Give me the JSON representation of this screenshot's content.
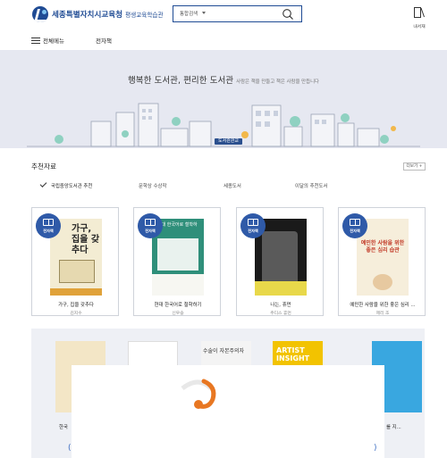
{
  "header": {
    "logo_name": "세종특별자치시교육청",
    "logo_sub": "평생교육학습관",
    "search_select": "통합검색",
    "mylib_label": "내서재"
  },
  "nav": {
    "menu_label": "전체메뉴",
    "item": "전자책"
  },
  "banner": {
    "main": "행복한 도서관, 편리한 도서관",
    "sub": "사람은 책을 만들고 책은 사람을 만듭니다",
    "sign": "도서관관교"
  },
  "recommended": {
    "title": "추천자료",
    "more": "더보기 +",
    "tabs": [
      "국립중앙도서관 추천",
      "문학상 수상작",
      "세종도서",
      "이달의 추천도서"
    ],
    "badge_label": "전자책",
    "books": [
      {
        "title": "가구, 집을 갖추다",
        "author": "김지수",
        "cover_text": "가구, 집을 갖추다"
      },
      {
        "title": "현대 한국어로 철학하기",
        "author": "신우승",
        "cover_text": "현대 한국어로 철학하기"
      },
      {
        "title": "나는, 휴먼",
        "author": "주디스 휴먼",
        "cover_text": ""
      },
      {
        "title": "예민한 사람을 위한 좋은 심리 ...",
        "author": "제리 조",
        "cover_text": "예민한 사람을 위한 좋은 심리 습관"
      }
    ]
  },
  "list": {
    "labels": [
      "한국",
      "를 지..."
    ],
    "covers": [
      "수술이 자본주의자",
      "ARTIST INSIGHT"
    ]
  },
  "colors": {
    "brand": "#1f4b94",
    "badge": "#2f5aa8",
    "banner_bg": "#e6e8f1",
    "spinner": "#e87722"
  }
}
